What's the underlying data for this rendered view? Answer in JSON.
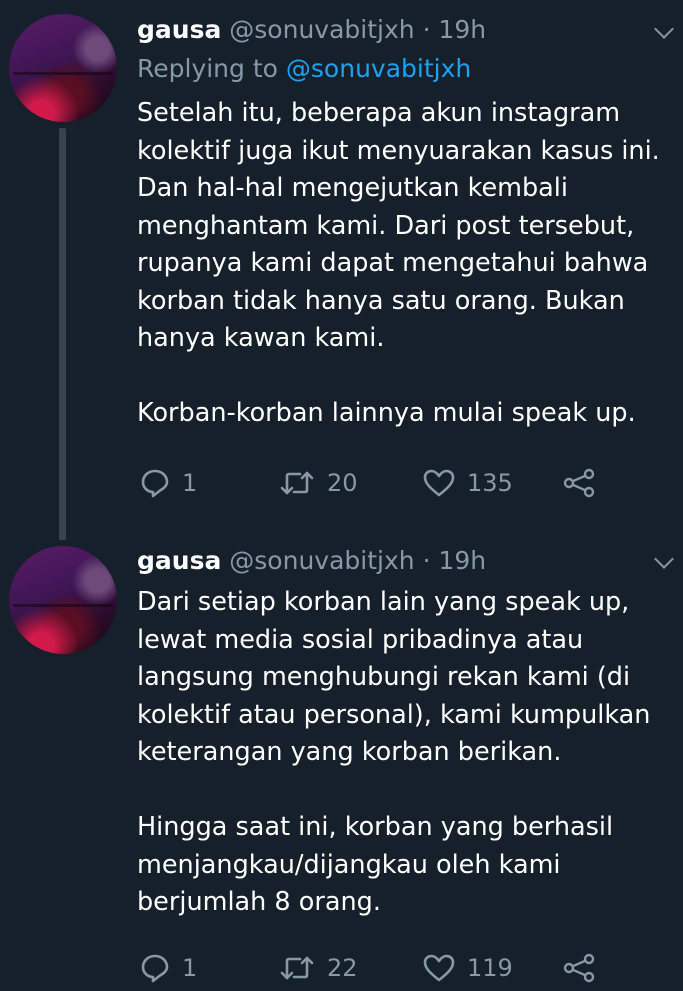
{
  "tweets": [
    {
      "name": "gausa",
      "handle": "@sonuvabitjxh",
      "separator": "·",
      "time": "19h",
      "replying_prefix": "Replying to",
      "replying_to": "@sonuvabitjxh",
      "lines": [
        "Setelah itu, beberapa akun instagram",
        "kolektif juga ikut menyuarakan kasus ini.",
        "Dan hal-hal mengejutkan kembali",
        "menghantam kami. Dari post tersebut,",
        "rupanya kami dapat mengetahui bahwa",
        "korban tidak hanya satu orang. Bukan",
        "hanya kawan kami.",
        "",
        "Korban-korban lainnya mulai speak up."
      ],
      "replies": "1",
      "retweets": "20",
      "likes": "135"
    },
    {
      "name": "gausa",
      "handle": "@sonuvabitjxh",
      "separator": "·",
      "time": "19h",
      "lines": [
        "Dari setiap korban lain yang speak up,",
        "lewat media sosial pribadinya atau",
        "langsung menghubungi rekan kami (di",
        "kolektif atau personal), kami kumpulkan",
        "keterangan yang korban berikan.",
        "",
        "Hingga saat ini, korban yang berhasil",
        "menjangkau/dijangkau oleh kami",
        "berjumlah 8 orang."
      ],
      "replies": "1",
      "retweets": "22",
      "likes": "119"
    }
  ],
  "icons": {
    "reply": "reply-icon",
    "retweet": "retweet-icon",
    "like": "heart-icon",
    "share": "share-icon",
    "menu": "chevron-down-icon"
  },
  "colors": {
    "background": "#15202b",
    "text": "#ffffff",
    "secondary": "#8899a6",
    "link": "#1da1f2",
    "thread_line": "#38444d"
  }
}
